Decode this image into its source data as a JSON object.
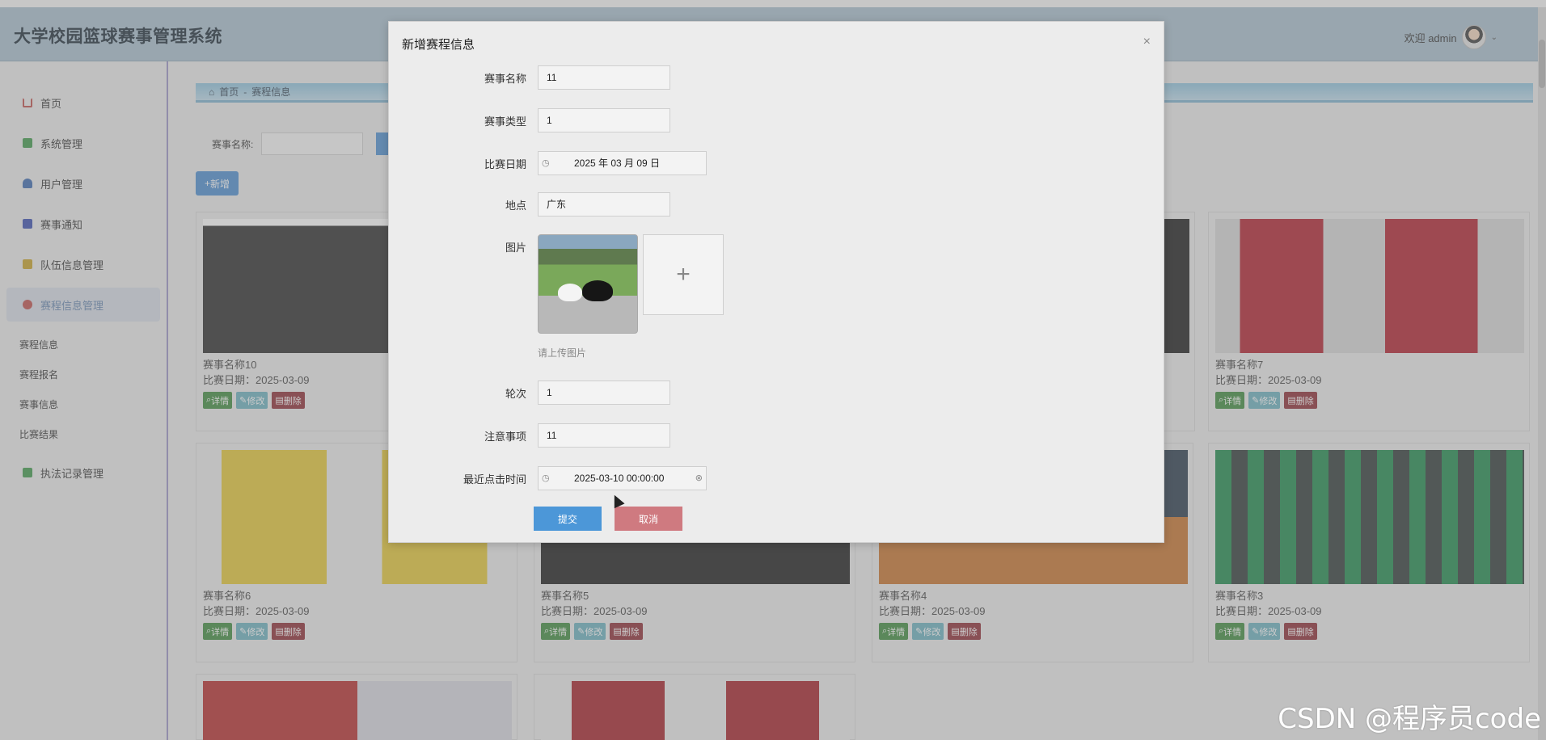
{
  "app": {
    "title": "大学校园篮球赛事管理系统",
    "welcome": "欢迎 admin"
  },
  "sidebar": {
    "items": [
      {
        "label": "首页",
        "color": "#c0504d"
      },
      {
        "label": "系统管理",
        "color": "#3f9a4b"
      },
      {
        "label": "用户管理",
        "color": "#3c69b0"
      },
      {
        "label": "赛事通知",
        "color": "#3a4fb0"
      },
      {
        "label": "队伍信息管理",
        "color": "#c9a227"
      },
      {
        "label": "赛程信息管理",
        "color": "#c0504d"
      },
      {
        "label": "执法记录管理",
        "color": "#3f9a4b"
      }
    ],
    "subitems": [
      "赛程信息",
      "赛程报名",
      "赛事信息",
      "比赛结果"
    ]
  },
  "breadcrumb": {
    "home": "首页",
    "sep": "-",
    "current": "赛程信息"
  },
  "search": {
    "label": "赛事名称:"
  },
  "add_button": "新增",
  "cards": [
    {
      "name": "赛事名称10",
      "date": "比赛日期：2025-03-09"
    },
    {
      "name": "赛事名称7",
      "date": "比赛日期：2025-03-09"
    },
    {
      "name": "赛事名称6",
      "date": "比赛日期：2025-03-09"
    },
    {
      "name": "赛事名称5",
      "date": "比赛日期：2025-03-09"
    },
    {
      "name": "赛事名称4",
      "date": "比赛日期：2025-03-09"
    },
    {
      "name": "赛事名称3",
      "date": "比赛日期：2025-03-09"
    }
  ],
  "card_buttons": {
    "detail": "详情",
    "edit": "修改",
    "delete": "删除"
  },
  "modal": {
    "title": "新增赛程信息",
    "fields": {
      "name": {
        "label": "赛事名称",
        "value": "11"
      },
      "type": {
        "label": "赛事类型",
        "value": "1"
      },
      "date": {
        "label": "比赛日期",
        "value": "2025 年 03 月 09 日"
      },
      "place": {
        "label": "地点",
        "value": "广东"
      },
      "image": {
        "label": "图片",
        "tip": "请上传图片"
      },
      "round": {
        "label": "轮次",
        "value": "1"
      },
      "notes": {
        "label": "注意事项",
        "value": "11"
      },
      "clicktime": {
        "label": "最近点击时间",
        "value": "2025-03-10 00:00:00"
      }
    },
    "submit": "提交",
    "cancel": "取消"
  },
  "watermark": "CSDN @程序员code"
}
